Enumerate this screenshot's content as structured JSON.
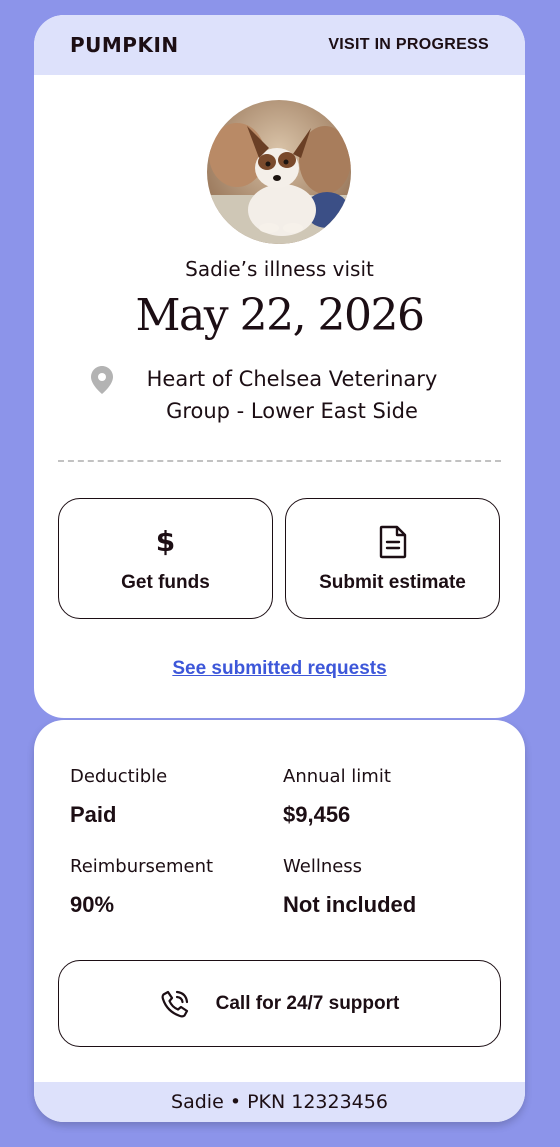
{
  "header": {
    "brand": "PUMPKIN",
    "status": "VISIT IN PROGRESS"
  },
  "pet_photo": {
    "icon": "dog-photo"
  },
  "visit": {
    "title": "Sadie’s illness visit",
    "date": "May 22, 2026",
    "location_icon": "location-pin-icon",
    "location": "Heart of Chelsea Veterinary Group - Lower East Side"
  },
  "actions": {
    "get_funds": {
      "icon": "$",
      "label": "Get funds"
    },
    "submit_estimate": {
      "icon": "document-icon",
      "label": "Submit estimate"
    }
  },
  "requests_link": "See submitted requests",
  "plan": {
    "deductible_label": "Deductible",
    "deductible_value": "Paid",
    "annual_limit_label": "Annual limit",
    "annual_limit_value": "$9,456",
    "reimbursement_label": "Reimbursement",
    "reimbursement_value": "90%",
    "wellness_label": "Wellness",
    "wellness_value": "Not included"
  },
  "support": {
    "icon": "phone-call-icon",
    "label": "Call for 24/7 support"
  },
  "footer": "Sadie • PKN 12323456",
  "colors": {
    "background": "#8c94ea",
    "header_band": "#dde1fb",
    "text": "#1c0e14",
    "link": "#3d57d9"
  }
}
